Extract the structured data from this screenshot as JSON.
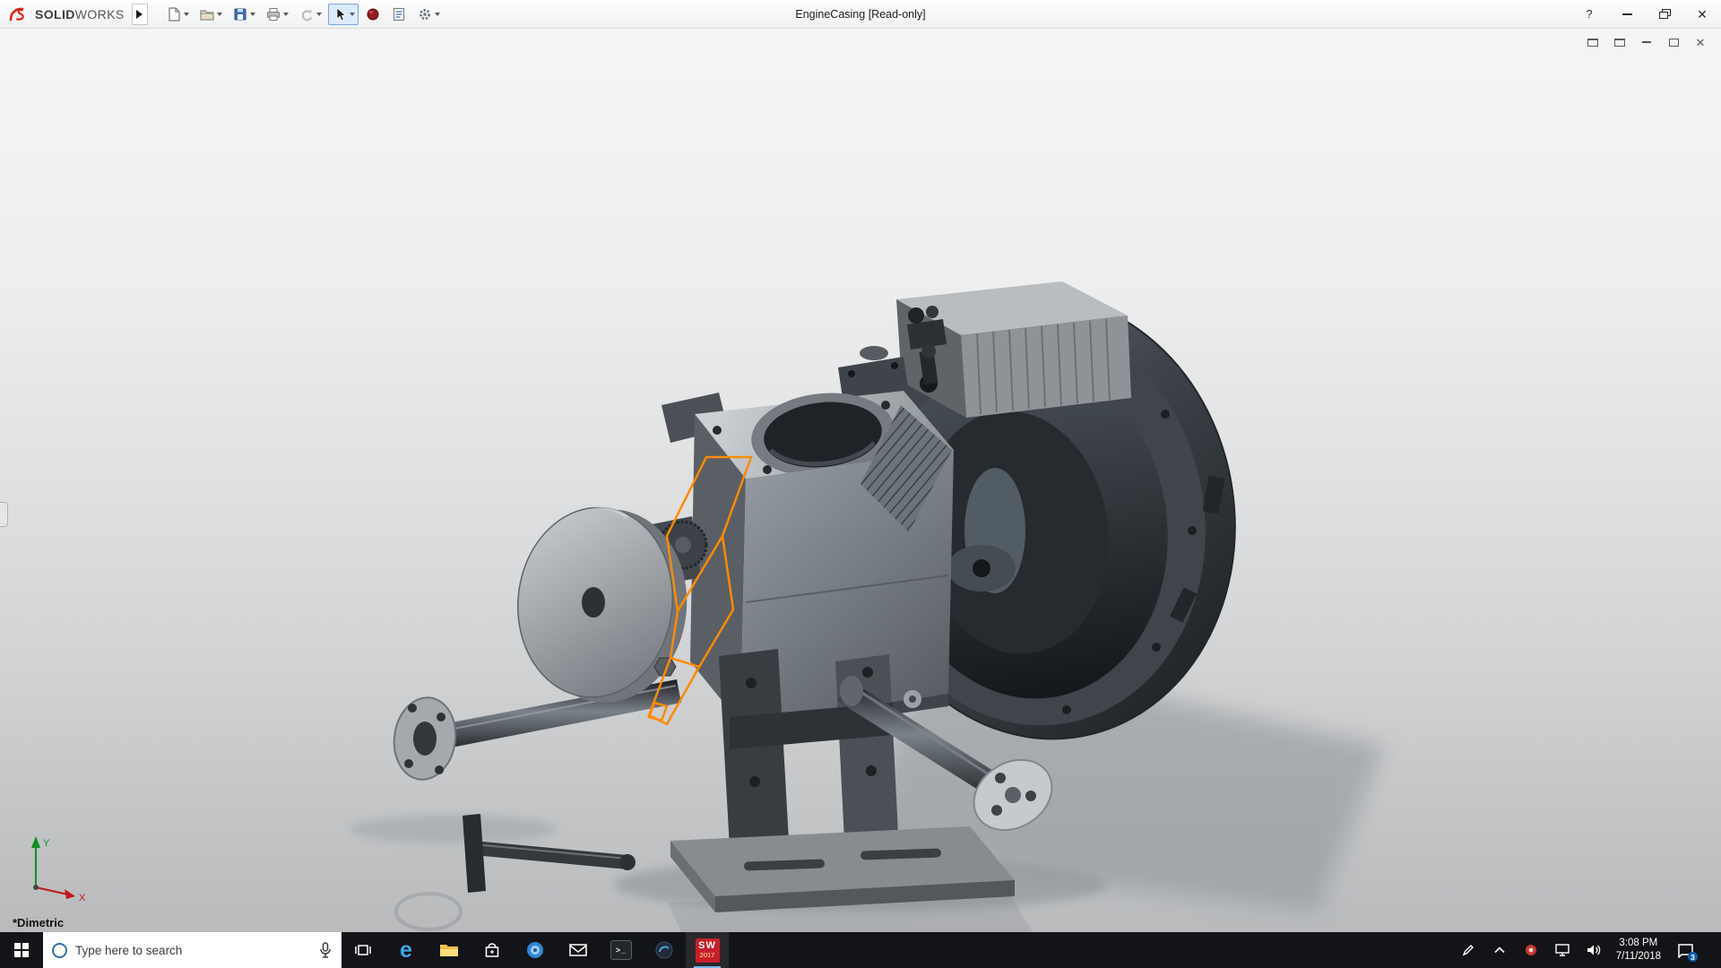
{
  "titlebar": {
    "brand_solid": "SOLID",
    "brand_works": "WORKS",
    "title": "EngineCasing [Read-only]",
    "help_label": "?",
    "tools": [
      "new-document",
      "open",
      "save",
      "print",
      "undo",
      "select",
      "render-sphere",
      "file-properties",
      "options"
    ]
  },
  "doc_window": {
    "controls": [
      "doc-window-left",
      "doc-window-right",
      "minimize",
      "maximize",
      "close"
    ]
  },
  "viewport": {
    "view_label": "*Dimetric",
    "axis_x_label": "X",
    "axis_y_label": "Y"
  },
  "taskbar": {
    "search_placeholder": "Type here to search",
    "edge_letter": "e",
    "terminal_glyph": ">_",
    "solidworks_tile_line1": "SW",
    "solidworks_tile_line2": "2017",
    "clock_time": "3:08 PM",
    "clock_date": "7/11/2018",
    "notification_badge": "3"
  },
  "colors": {
    "sketch_orange": "#ff8a00",
    "solidworks_red": "#c8202a",
    "taskbar_bg": "#121417"
  }
}
